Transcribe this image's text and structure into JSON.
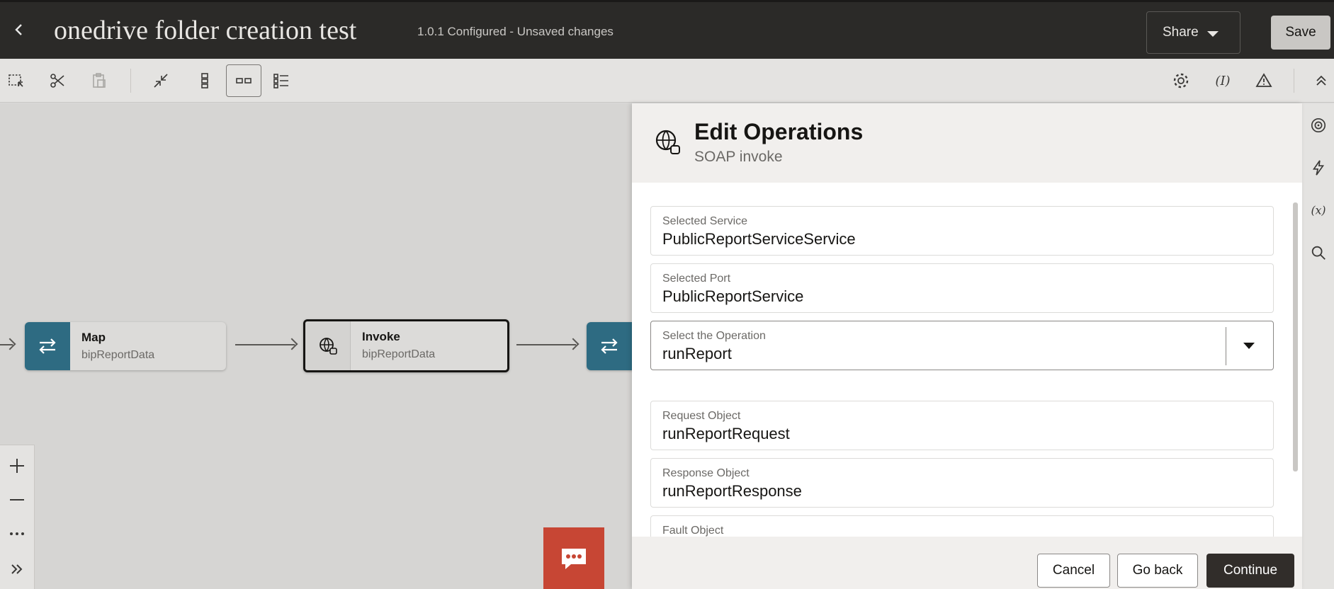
{
  "header": {
    "title": "onedrive folder creation test",
    "status": "1.0.1 Configured - Unsaved changes",
    "share_label": "Share",
    "save_label": "Save"
  },
  "canvas": {
    "nodes": [
      {
        "title": "Map",
        "subtitle": "bipReportData",
        "icon": "swap-arrows-icon"
      },
      {
        "title": "Invoke",
        "subtitle": "bipReportData",
        "icon": "globe-plug-icon"
      }
    ]
  },
  "drawer": {
    "title": "Edit Operations",
    "subtitle": "SOAP invoke",
    "fields": [
      {
        "label": "Selected Service",
        "value": "PublicReportServiceService"
      },
      {
        "label": "Selected Port",
        "value": "PublicReportService"
      },
      {
        "label": "Select the Operation",
        "value": "runReport"
      },
      {
        "label": "Request Object",
        "value": "runReportRequest"
      },
      {
        "label": "Response Object",
        "value": "runReportResponse"
      },
      {
        "label": "Fault Object",
        "value": ""
      }
    ],
    "buttons": {
      "cancel": "Cancel",
      "go_back": "Go back",
      "continue": "Continue"
    }
  },
  "colors": {
    "header_bg": "#2b2a28",
    "teal_node": "#2e6b82",
    "chat_red": "#c74634",
    "primary_btn": "#312d2a"
  }
}
